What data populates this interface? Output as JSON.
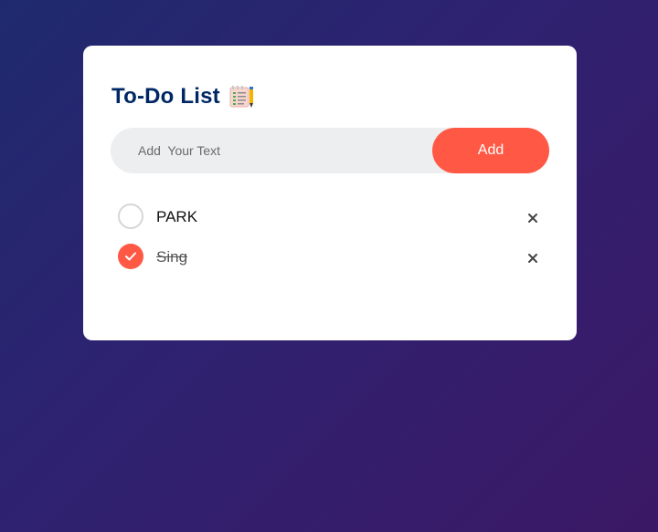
{
  "app": {
    "title": "To-Do List",
    "title_icon": "notepad-pencil-icon",
    "accent_color": "#ff5945",
    "title_color": "#002765"
  },
  "input": {
    "placeholder": "Add  Your Text",
    "value": ""
  },
  "add_button": {
    "label": "Add"
  },
  "tasks": [
    {
      "text": "PARK",
      "checked": false,
      "remove_icon": "close-icon"
    },
    {
      "text": "Sing",
      "checked": true,
      "remove_icon": "close-icon"
    }
  ]
}
